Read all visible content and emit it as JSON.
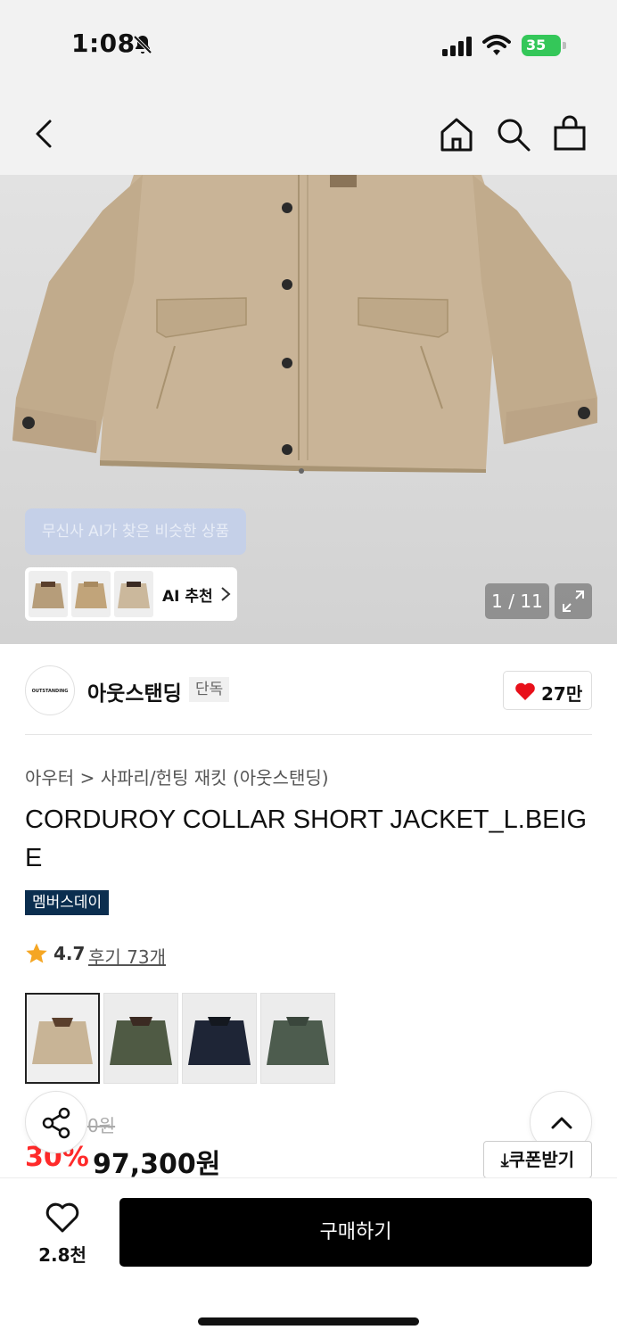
{
  "status_bar": {
    "time": "1:08",
    "battery": "35",
    "icons": [
      "bell-slash-icon",
      "signal-icon",
      "wifi-icon",
      "battery-icon"
    ]
  },
  "top_nav": {
    "icons": [
      "back-chevron-icon",
      "home-icon",
      "search-icon",
      "shopping-bag-icon"
    ]
  },
  "gallery": {
    "ai_tooltip": "무신사 AI가 찾은 비슷한 상품",
    "ai_recommend_label": "AI 추천",
    "counter": "1 / 11",
    "expand_icon": "expand-icon"
  },
  "brand": {
    "logo_text": "OUTSTANDING",
    "name": "아웃스탠딩",
    "badge": "단독",
    "like_count": "27만"
  },
  "product": {
    "category": "아우터",
    "subcategory": "사파리/헌팅 재킷 (아웃스탠딩)",
    "title": "CORDUROY COLLAR SHORT JACKET_L.BEIGE",
    "event_badge": "멤버스데이",
    "rating": "4.7",
    "review_label": "후기 73개",
    "color_options": [
      {
        "color": "#c8b496",
        "collar": "#5a3f2c",
        "selected": true
      },
      {
        "color": "#4f5a44",
        "collar": "#3b2a22",
        "selected": false
      },
      {
        "color": "#1e2536",
        "collar": "#14181f",
        "selected": false
      },
      {
        "color": "#4d5c4e",
        "collar": "#3a463c",
        "selected": false
      }
    ]
  },
  "price": {
    "original": "0원",
    "discount": "30%",
    "sale": "97,300원",
    "coupon_label": "쿠폰받기"
  },
  "bottom_bar": {
    "wish_count": "2.8천",
    "buy_label": "구매하기"
  },
  "colors": {
    "discount_red": "#ff2a2a",
    "event_badge_bg": "#0b2e4f",
    "heart_red": "#e8101a",
    "star_orange": "#f5a623",
    "jacket_beige": "#c9b497"
  }
}
